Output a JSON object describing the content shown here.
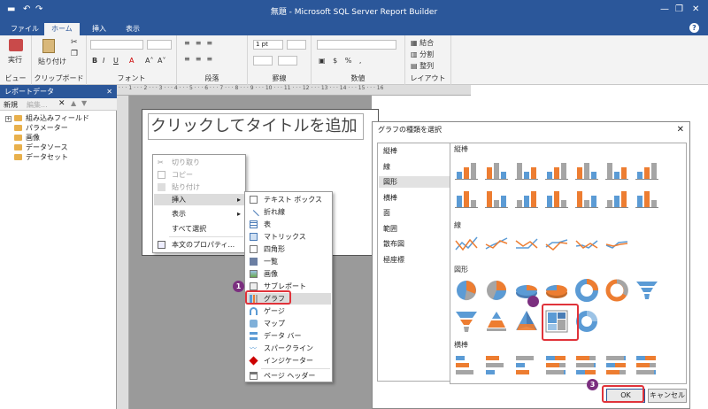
{
  "window": {
    "title": "無題 - Microsoft SQL Server Report Builder",
    "help": "?"
  },
  "tabs": [
    "ファイル",
    "ホーム",
    "挿入",
    "表示"
  ],
  "ribbon": {
    "groups": [
      "ビュー",
      "クリップボード",
      "フォント",
      "段落",
      "罫線",
      "数値",
      "レイアウト"
    ],
    "run_label": "実行",
    "paste_label": "貼り付け",
    "border_size": "1 pt",
    "merge_label": "結合",
    "split_label": "分割",
    "align_label": "整列"
  },
  "report_data": {
    "header": "レポートデータ",
    "toolbar": {
      "new": "新規",
      "edit": "編集..."
    },
    "items": [
      "組み込みフィールド",
      "パラメーター",
      "画像",
      "データソース",
      "データセット"
    ]
  },
  "page": {
    "title_placeholder": "クリックしてタイトルを追加"
  },
  "context_menu": {
    "items": [
      "切り取り",
      "コピー",
      "貼り付け",
      "挿入",
      "表示",
      "すべて選択",
      "本文のプロパティ..."
    ]
  },
  "insert_menu": {
    "items": [
      "テキスト ボックス",
      "折れ線",
      "表",
      "マトリックス",
      "四角形",
      "一覧",
      "画像",
      "サブレポート",
      "グラフ",
      "ゲージ",
      "マップ",
      "データ バー",
      "スパークライン",
      "インジケーター",
      "ページ ヘッダー"
    ]
  },
  "dialog": {
    "title": "グラフの種類を選択",
    "categories": [
      "縦棒",
      "線",
      "図形",
      "横棒",
      "面",
      "範囲",
      "散布図",
      "極座標"
    ],
    "selected_category": "図形",
    "sections": [
      "縦棒",
      "線",
      "図形",
      "横棒"
    ],
    "ok": "OK",
    "cancel": "キャンセル"
  },
  "steps": [
    "1",
    "2",
    "3"
  ],
  "colors": {
    "accent": "#2b579a",
    "chart_blue": "#5b9bd5",
    "chart_orange": "#ed7d31",
    "chart_gray": "#a5a5a5",
    "highlight": "#e0333a",
    "badge": "#7b2f7f"
  }
}
